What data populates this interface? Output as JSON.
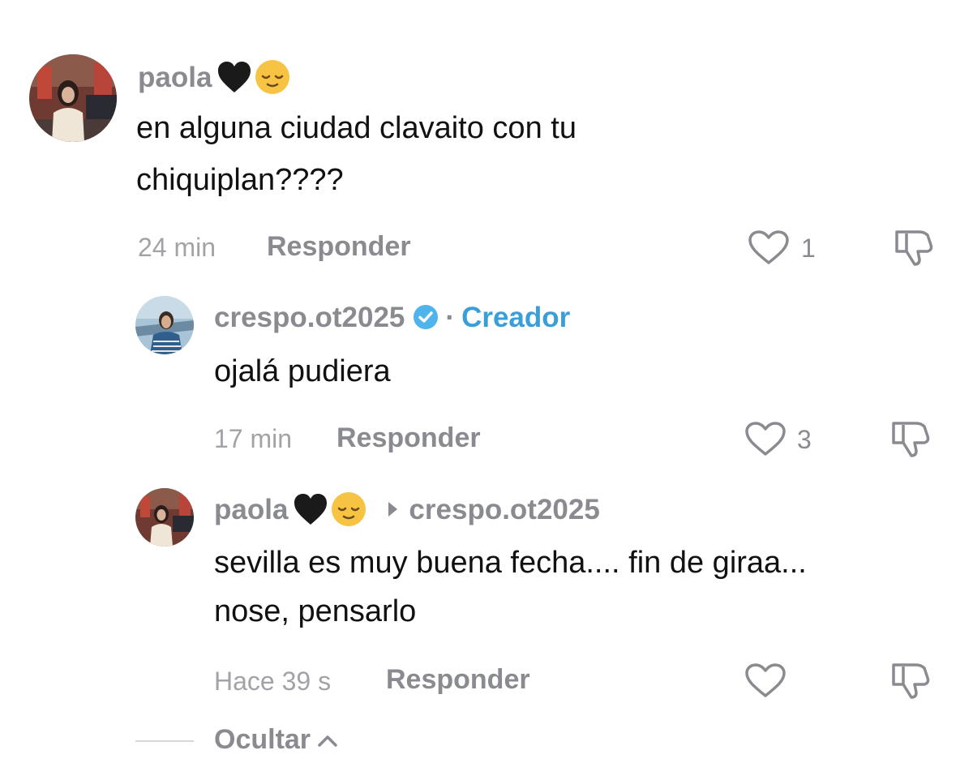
{
  "comments": [
    {
      "username": "paola",
      "text_lines": [
        "en alguna ciudad clavaito con tu",
        "chiquiplan????"
      ],
      "time": "24 min",
      "reply_label": "Responder",
      "likes": "1"
    },
    {
      "username": "crespo.ot2025",
      "creator_separator": "·",
      "creator_label": "Creador",
      "text_lines": [
        "ojalá pudiera"
      ],
      "time": "17 min",
      "reply_label": "Responder",
      "likes": "3"
    },
    {
      "username": "paola",
      "reply_to": "crespo.ot2025",
      "text_lines": [
        "sevilla es muy buena fecha.... fin de giraa...",
        "nose, pensarlo"
      ],
      "time": "Hace 39 s",
      "reply_label": "Responder",
      "likes": ""
    }
  ],
  "hide_label": "Ocultar",
  "colors": {
    "muted": "#8a8b91",
    "time": "#a2a3a8",
    "creator": "#3a9fd8",
    "verified": "#4fb4ec",
    "text": "#111111"
  },
  "icons": {
    "heart": "heart-outline-icon",
    "dislike": "thumbs-down-icon",
    "verified": "verified-badge-icon",
    "black_heart": "black-heart-emoji",
    "relieved_face": "relieved-face-emoji",
    "chevron": "chevron-up-icon"
  }
}
